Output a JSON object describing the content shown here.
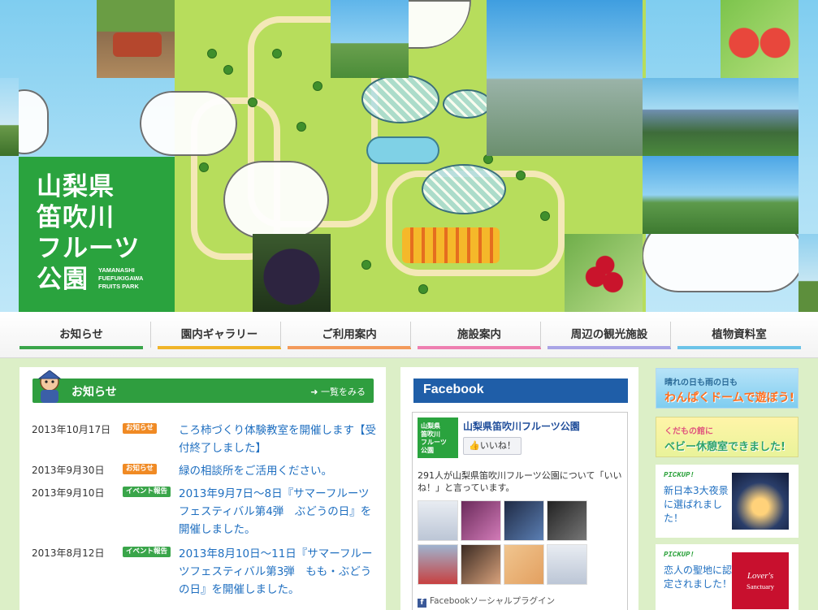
{
  "logo": {
    "jp_lines": [
      "山梨県",
      "笛吹川",
      "フルーツ",
      "公園"
    ],
    "en_lines": [
      "YAMANASHI",
      "FUEFUKIGAWA",
      "FRUITS PARK"
    ]
  },
  "nav": {
    "items": [
      {
        "label": "お知らせ",
        "color": "#3aa54a"
      },
      {
        "label": "園内ギャラリー",
        "color": "#f0b429"
      },
      {
        "label": "ご利用案内",
        "color": "#f39a5b"
      },
      {
        "label": "施設案内",
        "color": "#ee7fb0"
      },
      {
        "label": "周辺の観光施設",
        "color": "#a9a4e6"
      },
      {
        "label": "植物資料室",
        "color": "#6cc3e8"
      }
    ]
  },
  "news": {
    "title": "お知らせ",
    "more_label": "一覧をみる",
    "items": [
      {
        "date": "2013年10月17日",
        "badge": "お知らせ",
        "badge_color": "#f08a24",
        "text": "ころ柿づくり体験教室を開催します【受付終了しました】"
      },
      {
        "date": "2013年9月30日",
        "badge": "お知らせ",
        "badge_color": "#f08a24",
        "text": "緑の相談所をご活用ください。"
      },
      {
        "date": "2013年9月10日",
        "badge": "イベント報告",
        "badge_color": "#3aa54a",
        "text": "2013年9月7日〜8日『サマーフルーツフェスティバル第4弾　ぶどうの日』を開催しました。"
      },
      {
        "date": "2013年8月12日",
        "badge": "イベント報告",
        "badge_color": "#3aa54a",
        "text": "2013年8月10日〜11日『サマーフルーツフェスティバル第3弾　もも・ぶどうの日』を開催しました。"
      }
    ]
  },
  "facebook": {
    "title": "Facebook",
    "page_name": "山梨県笛吹川フルーツ公園",
    "page_logo_lines": [
      "山梨県",
      "笛吹川",
      "フルーツ",
      "公園"
    ],
    "like_label": "いいね！",
    "count_text": "291人が山梨県笛吹川フルーツ公園について「いいね！」と言っています。",
    "plugin_label": "Facebookソーシャルプラグイン"
  },
  "banners": {
    "wanpaku": {
      "line1": "晴れの日も雨の日も",
      "line2": "わんぱくドームで遊ぼう!"
    },
    "baby": {
      "line1": "くだもの館に",
      "line2": "ベビー休憩室できました!"
    }
  },
  "pickups": [
    {
      "tag": "PICKUP!",
      "text": "新日本3大夜景に選ばれました！"
    },
    {
      "tag": "PICKUP!",
      "text": "恋人の聖地に認定されました！"
    }
  ]
}
